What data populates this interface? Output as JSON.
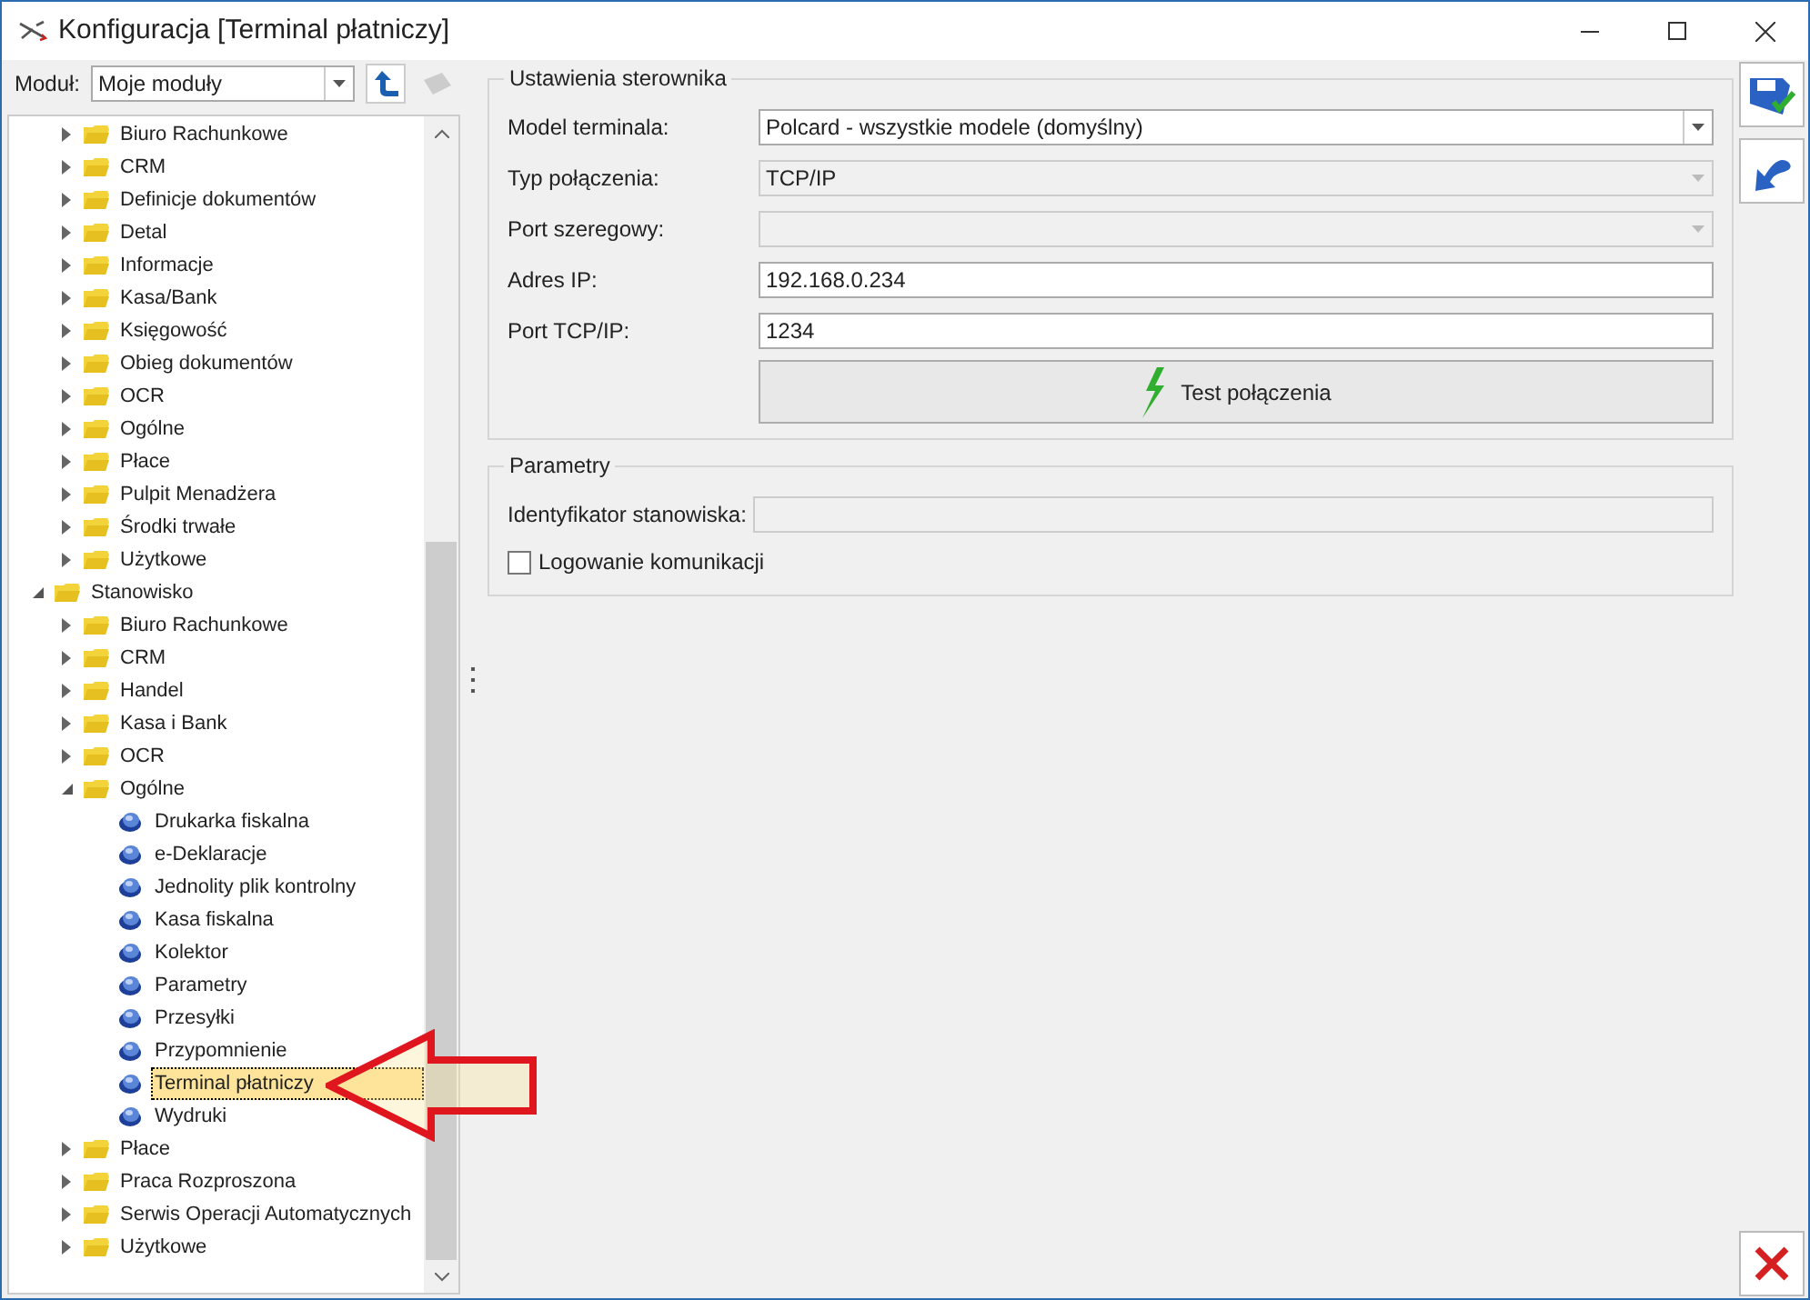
{
  "window": {
    "title": "Konfiguracja [Terminal płatniczy]"
  },
  "module": {
    "label": "Moduł:",
    "value": "Moje moduły"
  },
  "tree": [
    {
      "label": "Biuro Rachunkowe",
      "kind": "folder",
      "expanded": false,
      "selected": false
    },
    {
      "label": "CRM",
      "kind": "folder",
      "expanded": false,
      "selected": false
    },
    {
      "label": "Definicje dokumentów",
      "kind": "folder",
      "expanded": false,
      "selected": false
    },
    {
      "label": "Detal",
      "kind": "folder",
      "expanded": false,
      "selected": false
    },
    {
      "label": "Informacje",
      "kind": "folder",
      "expanded": false,
      "selected": false
    },
    {
      "label": "Kasa/Bank",
      "kind": "folder",
      "expanded": false,
      "selected": false
    },
    {
      "label": "Księgowość",
      "kind": "folder",
      "expanded": false,
      "selected": false
    },
    {
      "label": "Obieg dokumentów",
      "kind": "folder",
      "expanded": false,
      "selected": false
    },
    {
      "label": "OCR",
      "kind": "folder",
      "expanded": false,
      "selected": false
    },
    {
      "label": "Ogólne",
      "kind": "folder",
      "expanded": false,
      "selected": false
    },
    {
      "label": "Płace",
      "kind": "folder",
      "expanded": false,
      "selected": false
    },
    {
      "label": "Pulpit Menadżera",
      "kind": "folder",
      "expanded": false,
      "selected": false
    },
    {
      "label": "Środki trwałe",
      "kind": "folder",
      "expanded": false,
      "selected": false
    },
    {
      "label": "Użytkowe",
      "kind": "folder",
      "expanded": false,
      "selected": false
    },
    {
      "label": "Stanowisko",
      "kind": "root",
      "expanded": true,
      "selected": false,
      "children": [
        {
          "label": "Biuro Rachunkowe",
          "kind": "folder",
          "expanded": false,
          "selected": false
        },
        {
          "label": "CRM",
          "kind": "folder",
          "expanded": false,
          "selected": false
        },
        {
          "label": "Handel",
          "kind": "folder",
          "expanded": false,
          "selected": false
        },
        {
          "label": "Kasa i Bank",
          "kind": "folder",
          "expanded": false,
          "selected": false
        },
        {
          "label": "OCR",
          "kind": "folder",
          "expanded": false,
          "selected": false
        },
        {
          "label": "Ogólne",
          "kind": "folder",
          "expanded": true,
          "selected": false,
          "children": [
            {
              "label": "Drukarka fiskalna",
              "kind": "leaf",
              "selected": false
            },
            {
              "label": "e-Deklaracje",
              "kind": "leaf",
              "selected": false
            },
            {
              "label": "Jednolity plik kontrolny",
              "kind": "leaf",
              "selected": false
            },
            {
              "label": "Kasa fiskalna",
              "kind": "leaf",
              "selected": false
            },
            {
              "label": "Kolektor",
              "kind": "leaf",
              "selected": false
            },
            {
              "label": "Parametry",
              "kind": "leaf",
              "selected": false
            },
            {
              "label": "Przesyłki",
              "kind": "leaf",
              "selected": false
            },
            {
              "label": "Przypomnienie",
              "kind": "leaf",
              "selected": false
            },
            {
              "label": "Terminal płatniczy",
              "kind": "leaf",
              "selected": true
            },
            {
              "label": "Wydruki",
              "kind": "leaf",
              "selected": false
            }
          ]
        },
        {
          "label": "Płace",
          "kind": "folder",
          "expanded": false,
          "selected": false
        },
        {
          "label": "Praca Rozproszona",
          "kind": "folder",
          "expanded": false,
          "selected": false
        },
        {
          "label": "Serwis Operacji Automatycznych",
          "kind": "folder",
          "expanded": false,
          "selected": false
        },
        {
          "label": "Użytkowe",
          "kind": "folder",
          "expanded": false,
          "selected": false
        }
      ]
    }
  ],
  "groups": [
    {
      "title": "Ustawienia sterownika",
      "fields": [
        {
          "label": "Model terminala:",
          "kind": "dropdown",
          "value": "Polcard - wszystkie modele (domyślny)",
          "disabled": false
        },
        {
          "label": "Typ połączenia:",
          "kind": "dropdown",
          "value": "TCP/IP",
          "disabled": true
        },
        {
          "label": "Port szeregowy:",
          "kind": "dropdown",
          "disabled": true
        },
        {
          "label": "Adres IP:",
          "kind": "text",
          "value": "192.168.0.234",
          "disabled": false
        },
        {
          "label": "Port TCP/IP:",
          "kind": "text",
          "value": "1234",
          "disabled": false
        },
        {
          "label": "Test połączenia",
          "kind": "button",
          "disabled": false
        }
      ]
    },
    {
      "title": "Parametry",
      "fields": [
        {
          "label": "Identyfikator stanowiska:",
          "kind": "text",
          "disabled": true
        },
        {
          "label": "Logowanie komunikacji",
          "kind": "checkbox",
          "checked": false
        }
      ]
    }
  ]
}
